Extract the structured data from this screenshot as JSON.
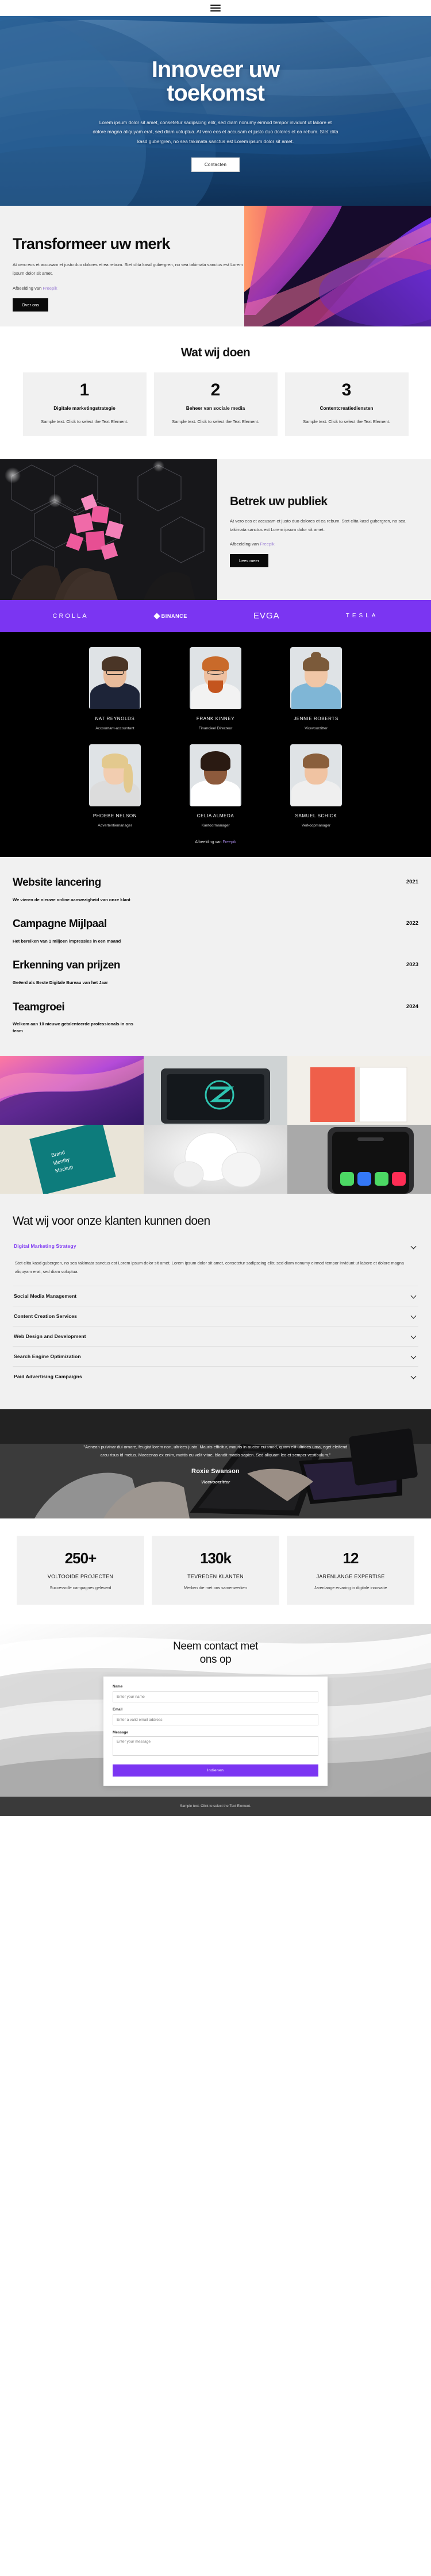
{
  "header": {
    "menu_icon": "hamburger-menu-icon"
  },
  "hero": {
    "title_line1": "Innoveer uw",
    "title_line2": "toekomst",
    "paragraph": "Lorem ipsum dolor sit amet, consetetur sadipscing elitr, sed diam nonumy eirmod tempor invidunt ut labore et dolore magna aliquyam erat, sed diam voluptua. At vero eos et accusam et justo duo dolores et ea rebum. Stet clita kasd gubergren, no sea takimata sanctus est Lorem ipsum dolor sit amet.",
    "cta": "Contacten"
  },
  "transform": {
    "heading": "Transformeer uw merk",
    "paragraph": "At vero eos et accusam et justo duo dolores et ea rebum. Stet clita kasd gubergren, no sea takimata sanctus est Lorem ipsum dolor sit amet.",
    "credit_prefix": "Afbeelding van ",
    "credit_link": "Freepik",
    "cta": "Over ons"
  },
  "services": {
    "title": "Wat wij doen",
    "cards": [
      {
        "num": "1",
        "title": "Digitale marketingstrategie",
        "desc": "Sample text. Click to select the Text Element."
      },
      {
        "num": "2",
        "title": "Beheer van sociale media",
        "desc": "Sample text. Click to select the Text Element."
      },
      {
        "num": "3",
        "title": "Contentcreatiediensten",
        "desc": "Sample text. Click to select the Text Element."
      }
    ]
  },
  "audience": {
    "heading": "Betrek uw publiek",
    "paragraph": "At vero eos et accusam et justo duo dolores et ea rebum. Stet clita kasd gubergren, no sea takimata sanctus est Lorem ipsum dolor sit amet.",
    "credit_prefix": "Afbeelding van ",
    "credit_link": "Freepik",
    "cta": "Lees meer"
  },
  "logos": [
    {
      "name": "CROLLA"
    },
    {
      "name": "BINANCE"
    },
    {
      "name": "EVGA"
    },
    {
      "name": "TESLA"
    }
  ],
  "team": {
    "members": [
      {
        "name": "NAT REYNOLDS",
        "role": "Accountant-accountant"
      },
      {
        "name": "FRANK KINNEY",
        "role": "Financieel Directeur"
      },
      {
        "name": "JENNIE ROBERTS",
        "role": "Vicevoorzitter"
      },
      {
        "name": "PHOEBE NELSON",
        "role": "Advertentiemanager"
      },
      {
        "name": "CELIA ALMEDA",
        "role": "Kantoormanager"
      },
      {
        "name": "SAMUEL SCHICK",
        "role": "Verkoopmanager"
      }
    ],
    "credit_prefix": "Afbeelding van ",
    "credit_link": "Freepik"
  },
  "timeline": [
    {
      "title": "Website lancering",
      "year": "2021",
      "desc": "We vieren de nieuwe online aanwezigheid van onze klant"
    },
    {
      "title": "Campagne Mijlpaal",
      "year": "2022",
      "desc": "Het bereiken van 1 miljoen impressies in een maand"
    },
    {
      "title": "Erkenning van prijzen",
      "year": "2023",
      "desc": "Geëerd als Beste Digitale Bureau van het Jaar"
    },
    {
      "title": "Teamgroei",
      "year": "2024",
      "desc": "Welkom aan 10 nieuwe getalenteerde professionals in ons team"
    }
  ],
  "faq": {
    "title": "Wat wij voor onze klanten kunnen doen",
    "items": [
      {
        "label": "Digital Marketing Strategy",
        "open": true,
        "body": "Stet clita kasd gubergren, no sea takimata sanctus est Lorem ipsum dolor sit amet. Lorem ipsum dolor sit amet, consetetur sadipscing elitr, sed diam nonumy eirmod tempor invidunt ut labore et dolore magna aliquyam erat, sed diam voluptua."
      },
      {
        "label": "Social Media Management",
        "open": false,
        "body": ""
      },
      {
        "label": "Content Creation Services",
        "open": false,
        "body": ""
      },
      {
        "label": "Web Design and Development",
        "open": false,
        "body": ""
      },
      {
        "label": "Search Engine Optimization",
        "open": false,
        "body": ""
      },
      {
        "label": "Paid Advertising Campaigns",
        "open": false,
        "body": ""
      }
    ]
  },
  "testimonial": {
    "quote": "\"Aenean pulvinar dui ornare, feugiat lorem non, ultrices justo. Mauris efficitur, mauris in auctor euismod, quam elit ultrices urna, eget eleifend arcu risus id metus. Maecenas ex enim, mattis eu velit vitae, blandit mattis sapien. Sed aliquam leo et semper vestibulum.\"",
    "author": "Roxie Swanson",
    "role": "Vicevoorzitter"
  },
  "stats": [
    {
      "value": "250+",
      "label": "VOLTOOIDE PROJECTEN",
      "sub": "Succesvolle campagnes geleverd"
    },
    {
      "value": "130k",
      "label": "TEVREDEN KLANTEN",
      "sub": "Merken die met ons samenwerken"
    },
    {
      "value": "12",
      "label": "JARENLANGE EXPERTISE",
      "sub": "Jarenlange ervaring in digitale innovatie"
    }
  ],
  "contact": {
    "title_line1": "Neem contact met",
    "title_line2": "ons op",
    "fields": [
      {
        "label": "Name",
        "placeholder": "Enter your name",
        "value": ""
      },
      {
        "label": "Email",
        "placeholder": "Enter a valid email address",
        "value": ""
      },
      {
        "label": "Message",
        "placeholder": "Enter your message",
        "value": ""
      }
    ],
    "submit": "Indienen"
  },
  "footer": {
    "text": "Sample text. Click to select the Text Element."
  },
  "colors": {
    "accent": "#7b35f2",
    "dark": "#0a0a0a",
    "light_panel": "#f1f1f1",
    "link": "#9b7fd4"
  }
}
